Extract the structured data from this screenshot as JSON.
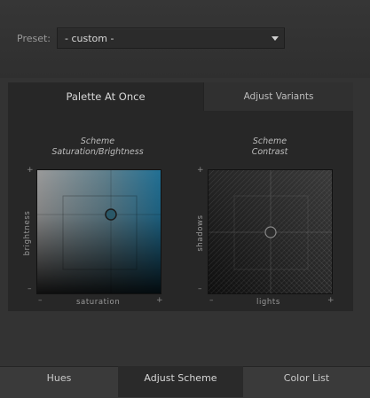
{
  "preset": {
    "label": "Preset:",
    "value": "- custom -"
  },
  "tabs": {
    "palette": "Palette At Once",
    "variants": "Adjust Variants"
  },
  "scheme_sb": {
    "title_line1": "Scheme",
    "title_line2": "Saturation/Brightness",
    "y_label": "brightness",
    "x_label": "saturation",
    "minus": "–",
    "plus": "+",
    "low_tick": "–"
  },
  "scheme_contrast": {
    "title_line1": "Scheme",
    "title_line2": "Contrast",
    "y_label": "shadows",
    "x_label": "lights",
    "minus": "–",
    "plus": "+",
    "low_tick": "–"
  },
  "bottom_tabs": {
    "hues": "Hues",
    "adjust": "Adjust Scheme",
    "colors": "Color List"
  },
  "colors": {
    "accent": "#2c6b87",
    "panel": "#272727",
    "background": "#333333"
  }
}
